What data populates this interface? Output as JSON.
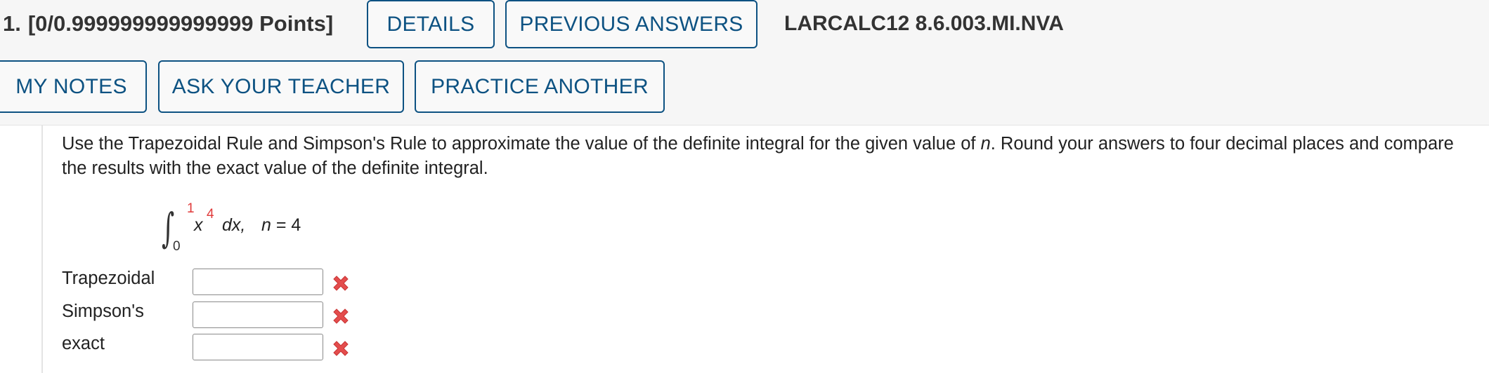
{
  "question": {
    "number": "1.",
    "points": "[0/0.999999999999999 Points]",
    "code": "LARCALC12 8.6.003.MI.NVA"
  },
  "toolbar": {
    "details_label": "DETAILS",
    "previous_answers_label": "PREVIOUS ANSWERS",
    "my_notes_label": "MY NOTES",
    "ask_teacher_label": "ASK YOUR TEACHER",
    "practice_another_label": "PRACTICE ANOTHER"
  },
  "problem": {
    "text_part1": "Use the Trapezoidal Rule and Simpson's Rule to approximate the value of the definite integral for the given value of ",
    "text_var": "n",
    "text_part2": ". Round your answers to four decimal places and compare the results with the exact value of the definite integral.",
    "integral": {
      "upper_limit": "1",
      "lower_limit": "0",
      "integrand_var": "x",
      "exponent": "4",
      "differential": "dx,",
      "n_var": "n",
      "n_value": " = 4"
    }
  },
  "answers": [
    {
      "label": "Trapezoidal",
      "value": "",
      "status_icon": "incorrect-x-icon"
    },
    {
      "label": "Simpson's",
      "value": "",
      "status_icon": "incorrect-x-icon"
    },
    {
      "label": "exact",
      "value": "",
      "status_icon": "incorrect-x-icon"
    }
  ],
  "colors": {
    "button_border": "#0d5282",
    "button_text": "#0d5282",
    "header_background": "#f6f6f6",
    "incorrect_icon": "#e44d4d",
    "integral_limit_highlight": "#e03a3a"
  }
}
